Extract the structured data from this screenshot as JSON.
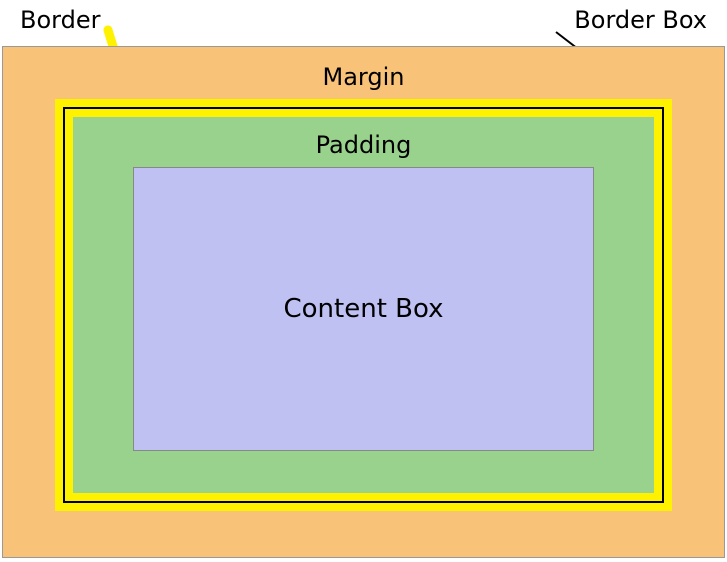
{
  "labels": {
    "border_external": "Border",
    "border_box_external": "Border Box",
    "margin": "Margin",
    "padding": "Padding",
    "content": "Content Box"
  },
  "colors": {
    "margin_bg": "#f8c278",
    "border_bg": "#fff200",
    "padding_bg": "#99d28c",
    "content_bg": "#bec1f2",
    "border_line": "#000000"
  }
}
